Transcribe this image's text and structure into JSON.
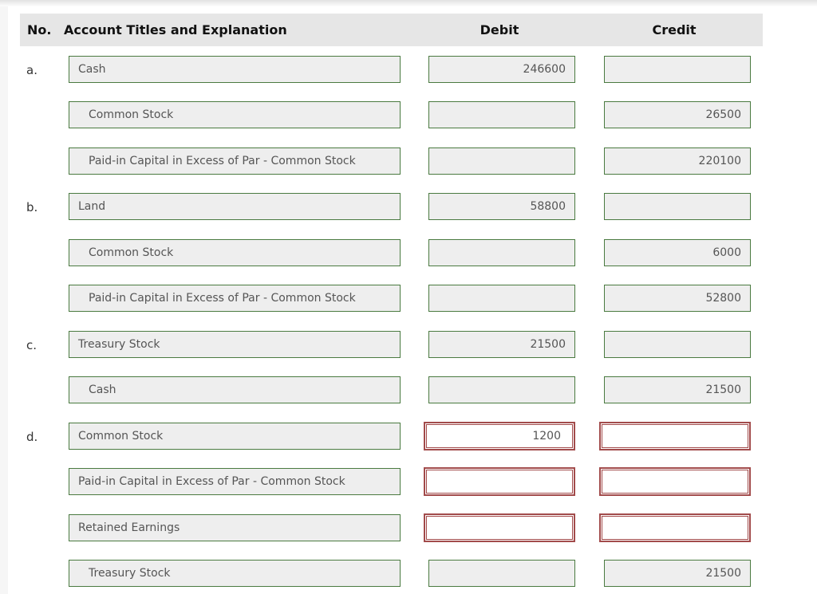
{
  "header": {
    "no": "No.",
    "account": "Account Titles and Explanation",
    "debit": "Debit",
    "credit": "Credit"
  },
  "entries": [
    {
      "label": "a.",
      "account": "Cash",
      "indent": false,
      "debit": "246600",
      "credit": "",
      "error": false
    },
    {
      "label": "",
      "account": "Common Stock",
      "indent": true,
      "debit": "",
      "credit": "26500",
      "error": false
    },
    {
      "label": "",
      "account": "Paid-in Capital in Excess of Par - Common Stock",
      "indent": true,
      "debit": "",
      "credit": "220100",
      "error": false
    },
    {
      "label": "b.",
      "account": "Land",
      "indent": false,
      "debit": "58800",
      "credit": "",
      "error": false
    },
    {
      "label": "",
      "account": "Common Stock",
      "indent": true,
      "debit": "",
      "credit": "6000",
      "error": false
    },
    {
      "label": "",
      "account": "Paid-in Capital in Excess of Par - Common Stock",
      "indent": true,
      "debit": "",
      "credit": "52800",
      "error": false
    },
    {
      "label": "c.",
      "account": "Treasury Stock",
      "indent": false,
      "debit": "21500",
      "credit": "",
      "error": false
    },
    {
      "label": "",
      "account": "Cash",
      "indent": true,
      "debit": "",
      "credit": "21500",
      "error": false
    },
    {
      "label": "d.",
      "account": "Common Stock",
      "indent": false,
      "debit": "1200",
      "credit": "",
      "error": true
    },
    {
      "label": "",
      "account": "Paid-in Capital in Excess of Par - Common Stock",
      "indent": false,
      "debit": "",
      "credit": "",
      "error": true
    },
    {
      "label": "",
      "account": "Retained Earnings",
      "indent": false,
      "debit": "",
      "credit": "",
      "error": true
    },
    {
      "label": "",
      "account": "Treasury Stock",
      "indent": true,
      "debit": "",
      "credit": "21500",
      "error": false
    }
  ]
}
